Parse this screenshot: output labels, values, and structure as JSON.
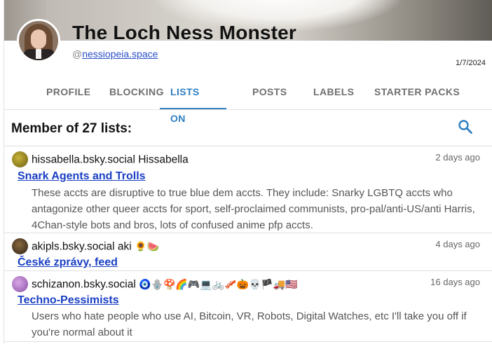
{
  "profile": {
    "display_name": "The Loch Ness Monster",
    "handle_prefix": "@",
    "handle": "nessiopeia.space",
    "date": "1/7/2024"
  },
  "tabs": [
    "PROFILE",
    "BLOCKING",
    "LISTS ON",
    "POSTS",
    "LABELS",
    "STARTER PACKS"
  ],
  "active_tab": "LISTS ON",
  "member_heading": "Member of 27 lists:",
  "icons": {
    "search": "search-icon"
  },
  "colors": {
    "accent": "#2f7fc1",
    "link": "#1a3fc4"
  },
  "lists": [
    {
      "author_handle": "hissabella.bsky.social",
      "author_name": "Hissabella",
      "author_extra": "",
      "time": "2 days ago",
      "list_name": "Snark Agents and Trolls",
      "description": "These accts are disruptive to true blue dem accts. They include: Snarky LGBTQ accts who antagonize other queer accts for sport, self-proclaimed communists, pro-pal/anti-US/anti Harris, 4Chan-style bots and bros, lots of confused anime pfp accts."
    },
    {
      "author_handle": "akipls.bsky.social",
      "author_name": "aki",
      "author_extra": "🌻🍉",
      "time": "4 days ago",
      "list_name": "České zprávy, feed",
      "description": ""
    },
    {
      "author_handle": "schizanon.bsky.social",
      "author_name": "🧿🪬🍄🌈🎮💻🚲🥓🎃💀🏴🚚🇺🇸",
      "author_extra": "",
      "time": "16 days ago",
      "list_name": "Techno-Pessimists",
      "description": "Users who hate people who use AI, Bitcoin, VR, Robots, Digital Watches, etc I'll take you off if you're normal about it"
    }
  ]
}
